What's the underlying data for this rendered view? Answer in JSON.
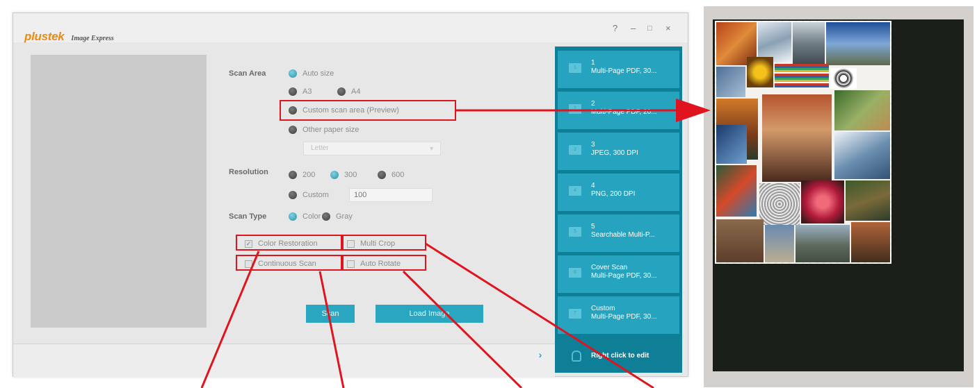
{
  "app": {
    "brand": "plustek",
    "product": "Image Express",
    "window_controls": {
      "help": "?",
      "minimize": "–",
      "maximize": "□",
      "close": "×"
    }
  },
  "scan_area": {
    "label": "Scan Area",
    "auto_size": "Auto size",
    "a3": "A3",
    "a4": "A4",
    "custom": "Custom scan area (Preview)",
    "other": "Other paper size",
    "paper_select_value": "Letter"
  },
  "resolution": {
    "label": "Resolution",
    "r200": "200",
    "r300": "300",
    "r600": "600",
    "custom": "Custom",
    "custom_value": "100"
  },
  "scan_type": {
    "label": "Scan Type",
    "color": "Color",
    "gray": "Gray"
  },
  "options": {
    "color_restoration": "Color Restoration",
    "multi_crop": "Multi Crop",
    "continuous_scan": "Continuous Scan",
    "auto_rotate": "Auto Rotate"
  },
  "buttons": {
    "scan": "Scan",
    "load_image": "Load Image"
  },
  "profiles": [
    {
      "number": "1",
      "name": "Multi-Page PDF, 30..."
    },
    {
      "number": "2",
      "name": "Multi-Page PDF, 20..."
    },
    {
      "number": "3",
      "name": "JPEG, 300 DPI"
    },
    {
      "number": "4",
      "name": "PNG, 200 DPI"
    },
    {
      "number": "5",
      "name": "Searchable Multi-P..."
    },
    {
      "number": "Cover Scan",
      "name": "Multi-Page PDF, 30..."
    },
    {
      "number": "Custom",
      "name": "Multi-Page PDF, 30..."
    }
  ],
  "profiles_hint": "Right click to edit",
  "colors": {
    "accent": "#26a4bf",
    "annotation": "#e0141f",
    "brand": "#e98b18"
  }
}
